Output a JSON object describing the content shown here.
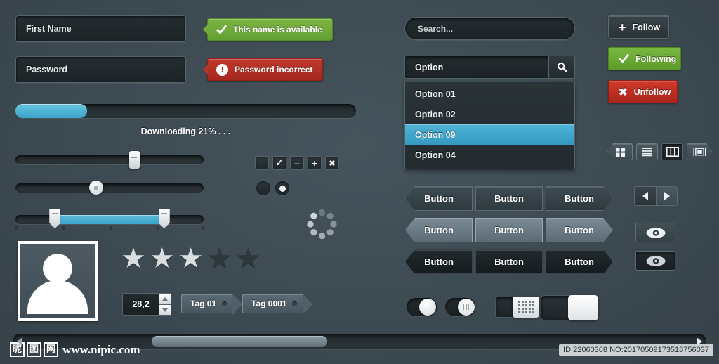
{
  "form": {
    "first_name_value": "First Name",
    "password_value": "Password",
    "tooltip_success": "This name is available",
    "tooltip_error": "Password incorrect",
    "success_color": "#7cb342",
    "error_color": "#c0392b"
  },
  "progress": {
    "percent": 21,
    "label": "Downloading 21% . . .",
    "fill_color": "#4baed0"
  },
  "sliders": {
    "slider1_percent": 63,
    "slider2_percent": 43,
    "range_start_percent": 21,
    "range_end_percent": 79
  },
  "checkboxes": [
    {
      "name": "unchecked",
      "glyph": ""
    },
    {
      "name": "checked",
      "glyph": "✓"
    },
    {
      "name": "minus",
      "glyph": "–"
    },
    {
      "name": "plus",
      "glyph": "+"
    },
    {
      "name": "close",
      "glyph": "✖"
    }
  ],
  "radios": [
    {
      "name": "radio-off",
      "selected": false
    },
    {
      "name": "radio-on",
      "selected": true
    }
  ],
  "rating": {
    "filled": 3,
    "total": 5,
    "star_glyph": "★"
  },
  "stepper": {
    "value": "28,2"
  },
  "tags": [
    {
      "label": "Tag 01"
    },
    {
      "label": "Tag 0001"
    }
  ],
  "search": {
    "placeholder": "Search...",
    "value": "Search..."
  },
  "combo": {
    "value": "Option",
    "search_icon": "search-icon",
    "options": [
      {
        "label": "Option 01",
        "selected": false
      },
      {
        "label": "Option 02",
        "selected": false
      },
      {
        "label": "Option 09",
        "selected": true
      },
      {
        "label": "Option 04",
        "selected": false
      }
    ],
    "selected_color": "#3fa6cb"
  },
  "follow": {
    "follow_label": "Follow",
    "follow_icon": "plus-icon",
    "following_label": "Following",
    "following_icon": "check-icon",
    "unfollow_label": "Unfollow",
    "unfollow_icon": "cross-icon",
    "following_color": "#6aa838",
    "unfollow_color": "#c0392b"
  },
  "view_toggles": [
    {
      "name": "grid-view-icon",
      "active": false
    },
    {
      "name": "list-view-icon",
      "active": false
    },
    {
      "name": "column-view-icon",
      "active": true
    },
    {
      "name": "gallery-view-icon",
      "active": false
    }
  ],
  "pager": {
    "prev_icon": "triangle-left-icon",
    "next_icon": "triangle-right-icon"
  },
  "visibility": [
    {
      "name": "eye-button-light"
    },
    {
      "name": "eye-button-dark"
    }
  ],
  "buttons_grid": {
    "label": "Button",
    "rows": [
      {
        "style": "dark",
        "items": [
          "Button",
          "Button",
          "Button"
        ]
      },
      {
        "style": "light",
        "items": [
          "Button",
          "Button",
          "Button"
        ]
      },
      {
        "style": "black",
        "items": [
          "Button",
          "Button",
          "Button"
        ]
      }
    ]
  },
  "switches": [
    {
      "name": "toggle-pill-on",
      "state": "on"
    },
    {
      "name": "toggle-pill-grip-on",
      "state": "on"
    },
    {
      "name": "toggle-rect-on",
      "state": "on"
    },
    {
      "name": "toggle-large-on",
      "state": "on"
    }
  ],
  "scrollbar": {
    "left_arrow": "scroll-left-arrow",
    "right_arrow": "scroll-right-arrow",
    "thumb_position_percent": 20
  },
  "watermark": {
    "cjk": [
      "昵",
      "图",
      "网"
    ],
    "url": "www.nipic.com",
    "id_text": "ID:22060368 NO:20170509173518756037"
  }
}
